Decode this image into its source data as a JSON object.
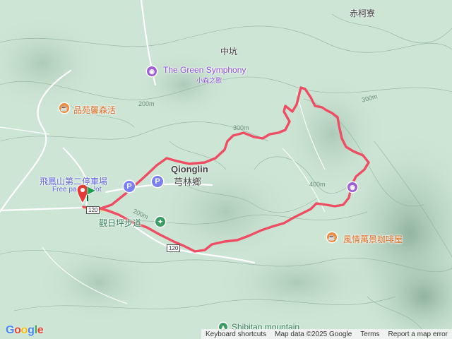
{
  "places": {
    "chikeliao": "赤柯寮",
    "zhongkeng": "中坑",
    "qionglin_en": "Qionglin",
    "qionglin_zh": "芎林鄉",
    "shibitan": "Shibitan mountain"
  },
  "pois": {
    "green_symphony": "The Green Symphony",
    "green_symphony_zh": "小森之歌",
    "pinyuan": "品苑馨森活",
    "parking_zh": "飛鳳山第二停車場",
    "parking_en": "Free parking lot",
    "guanri": "觀日坪步道",
    "fengqing": "風情萬景咖啡屋"
  },
  "contours": {
    "c200a": "200m",
    "c200b": "200m",
    "c300": "300m",
    "c400": "400m",
    "c300b": "300m"
  },
  "roads": {
    "r1": "120",
    "r2": "120"
  },
  "footer": {
    "shortcuts": "Keyboard shortcuts",
    "attribution": "Map data ©2025 Google",
    "terms": "Terms",
    "report": "Report a map error"
  },
  "logo": "Google",
  "colors": {
    "track": "#ee4d63",
    "poi_purple": "#9c5fd6",
    "poi_orange": "#f08b3c",
    "park_green": "#3d9c66",
    "marker_red": "#e53935",
    "marker_green": "#1e9e4b"
  }
}
